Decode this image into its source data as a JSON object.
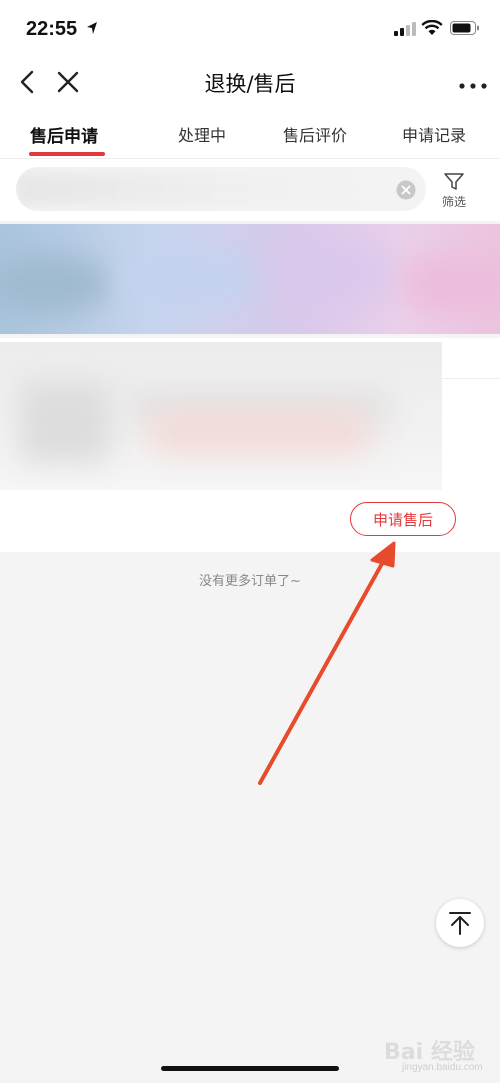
{
  "status_bar": {
    "time": "22:55"
  },
  "nav": {
    "title": "退换/售后"
  },
  "tabs": [
    {
      "label": "售后申请",
      "active": true
    },
    {
      "label": "处理中",
      "active": false
    },
    {
      "label": "售后评价",
      "active": false
    },
    {
      "label": "申请记录",
      "active": false
    }
  ],
  "search": {
    "filter_label": "筛选"
  },
  "order": {
    "apply_label": "申请售后"
  },
  "list": {
    "end_text": "没有更多订单了~"
  },
  "watermark": {
    "text": "Bai 经验",
    "sub": "jingyan.baidu.com"
  },
  "colors": {
    "accent": "#e4393c",
    "annotation_arrow": "#e84a2c"
  },
  "icons": {
    "back": "chevron-left-icon",
    "close": "close-icon",
    "more": "more-dots-icon",
    "filter": "funnel-icon",
    "clear": "clear-circle-icon",
    "top": "back-to-top-icon"
  }
}
